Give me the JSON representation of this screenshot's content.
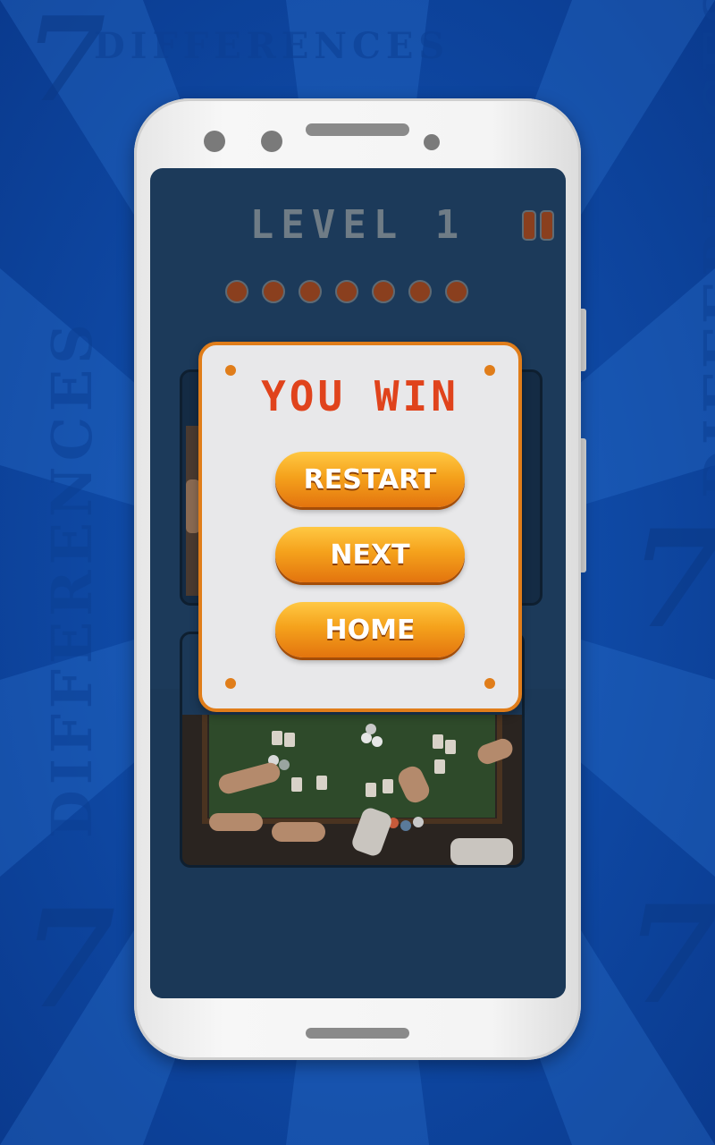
{
  "background": {
    "watermark_word": "DIFFERENCES",
    "watermark_digit": "7"
  },
  "game": {
    "level_label": "LEVEL 1",
    "differences_total": 7,
    "differences_found": 0,
    "pause_icon": "pause-icon"
  },
  "dialog": {
    "title": "YOU WIN",
    "buttons": {
      "restart": "RESTART",
      "next": "NEXT",
      "home": "HOME"
    }
  },
  "colors": {
    "background_blue": "#1a5fc0",
    "accent_orange": "#e07d1a",
    "title_red": "#e0431c",
    "dot_brown": "#8a3f1e"
  }
}
